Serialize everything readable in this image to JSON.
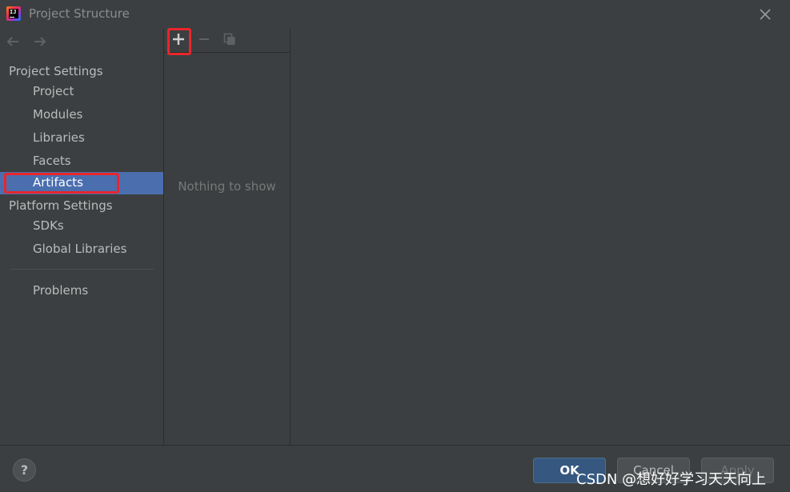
{
  "window": {
    "title": "Project Structure"
  },
  "sidebar": {
    "project_settings_header": "Project Settings",
    "project_items": [
      {
        "label": "Project"
      },
      {
        "label": "Modules"
      },
      {
        "label": "Libraries"
      },
      {
        "label": "Facets"
      },
      {
        "label": "Artifacts",
        "selected": true
      }
    ],
    "platform_settings_header": "Platform Settings",
    "platform_items": [
      {
        "label": "SDKs"
      },
      {
        "label": "Global Libraries"
      }
    ],
    "problems_label": "Problems"
  },
  "middle": {
    "toolbar_icons": [
      "add-icon",
      "remove-icon",
      "copy-icon"
    ],
    "empty_text": "Nothing to show"
  },
  "footer": {
    "help_label": "?",
    "ok_label": "OK",
    "cancel_label": "Cancel",
    "apply_label": "Apply",
    "watermark": "CSDN @想好好学习天天向上"
  },
  "colors": {
    "background": "#3c3f41",
    "selection": "#4b6eaf",
    "highlight_box": "#e8262b",
    "ok_button": "#365880"
  }
}
